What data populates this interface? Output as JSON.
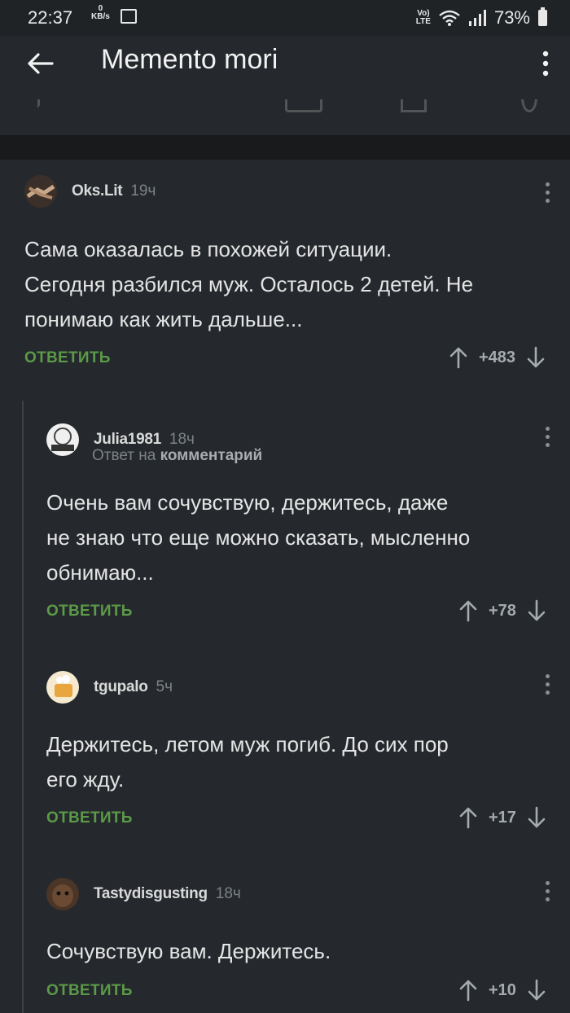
{
  "status_bar": {
    "time": "22:37",
    "net_speed_value": "0",
    "net_speed_unit": "KB/s",
    "volte_top": "Vo)",
    "volte_bottom": "LTE",
    "battery": "73%"
  },
  "app_bar": {
    "title": "Memento mori"
  },
  "comments": [
    {
      "author": "Oks.Lit",
      "time": "19ч",
      "text_lines": [
        "Сама оказалась в похожей ситуации.",
        "Сегодня разбился муж. Осталось 2 детей. Не",
        "понимаю как жить дальше..."
      ],
      "reply_label": "ОТВЕТИТЬ",
      "score": "+483"
    },
    {
      "author": "Julia1981",
      "time": "18ч",
      "reply_prefix": "Ответ на",
      "reply_target": "комментарий",
      "text_lines": [
        "Очень вам сочувствую, держитесь, даже",
        "не знаю что еще можно сказать, мысленно",
        "обнимаю..."
      ],
      "reply_label": "ОТВЕТИТЬ",
      "score": "+78"
    },
    {
      "author": "tgupalo",
      "time": "5ч",
      "text_lines": [
        "Держитесь, летом муж погиб. До сих пор",
        "его жду."
      ],
      "reply_label": "ОТВЕТИТЬ",
      "score": "+17"
    },
    {
      "author": "Tastydisgusting",
      "time": "18ч",
      "text_lines": [
        "Сочувствую вам. Держитесь."
      ],
      "reply_label": "ОТВЕТИТЬ",
      "score": "+10"
    }
  ],
  "colors": {
    "background": "#25292d",
    "accent_reply": "#5b9a47",
    "muted_text": "#7d8287"
  },
  "icons": [
    "back-arrow-icon",
    "overflow-menu-icon",
    "upvote-icon",
    "downvote-icon"
  ]
}
